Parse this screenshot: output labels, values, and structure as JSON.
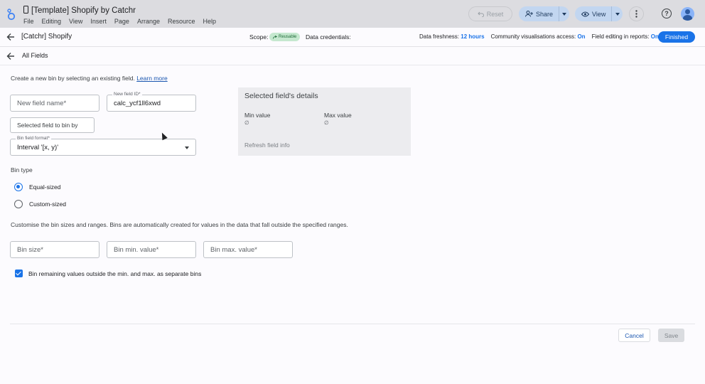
{
  "header": {
    "title": "[Template] Shopify by Catchr",
    "menu": [
      "File",
      "Editing",
      "View",
      "Insert",
      "Page",
      "Arrange",
      "Resource",
      "Help"
    ],
    "reset_label": "Reset",
    "share_label": "Share",
    "view_label": "View"
  },
  "databar": {
    "datasource_name": "[Catchr] Shopify",
    "scope_label": "Scope:",
    "scope_badge": "Reusable",
    "credentials_label": "Data credentials:",
    "freshness_label": "Data freshness:",
    "freshness_value": "12 hours",
    "community_label": "Community visualisations access:",
    "community_value": "On",
    "editing_label": "Field editing in reports:",
    "editing_value": "On",
    "finished_label": "Finished"
  },
  "fieldsbar": {
    "label": "All Fields"
  },
  "form": {
    "intro": "Create a new bin by selecting an existing field.",
    "learn_more": "Learn more",
    "new_field_name_placeholder": "New field name*",
    "new_field_id_label": "New field ID*",
    "new_field_id_value": "calc_ycf1ll6xwd",
    "selected_field_placeholder": "Selected field to bin by",
    "bin_format_label": "Bin field format*",
    "bin_format_value": "Interval '[x, y)'",
    "bin_type_label": "Bin type",
    "bin_type_options": [
      "Equal-sized",
      "Custom-sized"
    ],
    "bin_type_selected": "Equal-sized",
    "customise_text": "Customise the bin sizes and ranges. Bins are automatically created for values in the data that fall outside the specified ranges.",
    "bin_size_placeholder": "Bin size*",
    "bin_min_placeholder": "Bin min. value*",
    "bin_max_placeholder": "Bin max. value*",
    "remaining_checkbox_label": "Bin remaining values outside the min. and max. as separate bins",
    "remaining_checked": true
  },
  "details": {
    "title": "Selected field's details",
    "min_label": "Min value",
    "min_value": "∅",
    "max_label": "Max value",
    "max_value": "∅",
    "refresh_label": "Refresh field info"
  },
  "footer": {
    "cancel_label": "Cancel",
    "save_label": "Save"
  }
}
